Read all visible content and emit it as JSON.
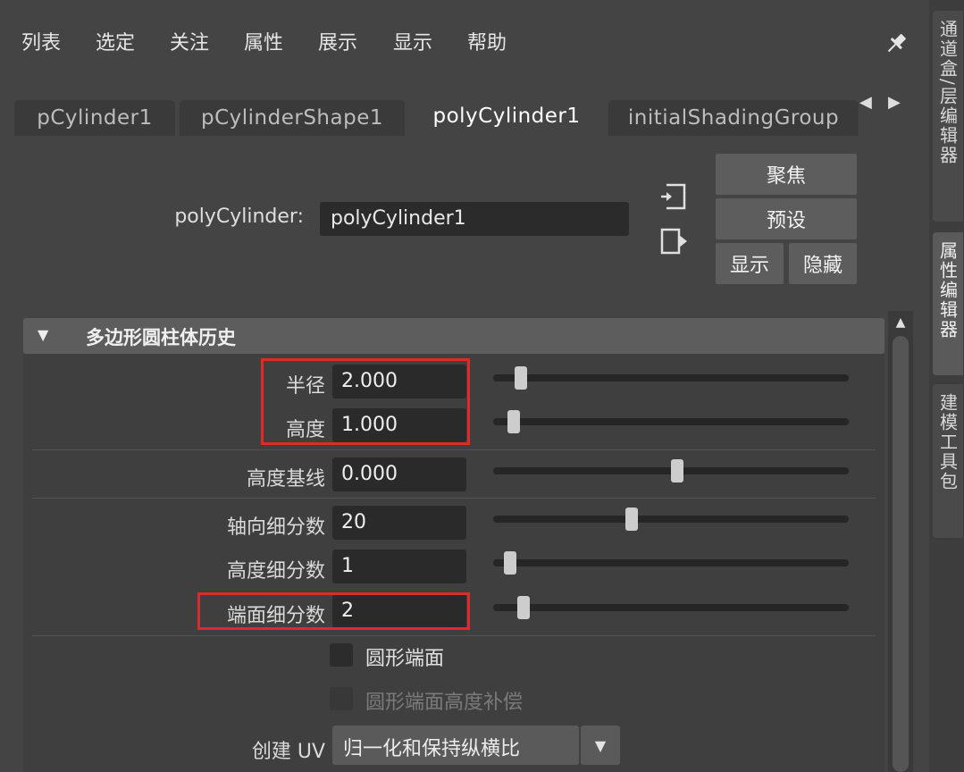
{
  "menu": [
    "列表",
    "选定",
    "关注",
    "属性",
    "展示",
    "显示",
    "帮助"
  ],
  "side_tabs": [
    "通道盒/层编辑器",
    "属性编辑器",
    "建模工具包"
  ],
  "node_tabs": [
    "pCylinder1",
    "pCylinderShape1",
    "polyCylinder1",
    "initialShadingGroup"
  ],
  "active_node_tab": "polyCylinder1",
  "node": {
    "label": "polyCylinder:",
    "value": "polyCylinder1"
  },
  "buttons": {
    "focus": "聚焦",
    "presets": "预设",
    "show": "显示",
    "hide": "隐藏"
  },
  "section": {
    "title": "多边形圆柱体历史"
  },
  "attributes": [
    {
      "label": "半径",
      "value": "2.000",
      "slider": 0.05
    },
    {
      "label": "高度",
      "value": "1.000",
      "slider": 0.03
    },
    {
      "label": "高度基线",
      "value": "0.000",
      "slider": 0.5
    },
    {
      "label": "轴向细分数",
      "value": "20",
      "slider": 0.37
    },
    {
      "label": "高度细分数",
      "value": "1",
      "slider": 0.02
    },
    {
      "label": "端面细分数",
      "value": "2",
      "slider": 0.06
    }
  ],
  "checkboxes": [
    {
      "label": "圆形端面",
      "enabled": true
    },
    {
      "label": "圆形端面高度补偿",
      "enabled": false
    }
  ],
  "uv": {
    "label": "创建 UV",
    "value": "归一化和保持纵横比"
  },
  "colors": {
    "highlight": "#e02a2a",
    "background": "#444444"
  }
}
